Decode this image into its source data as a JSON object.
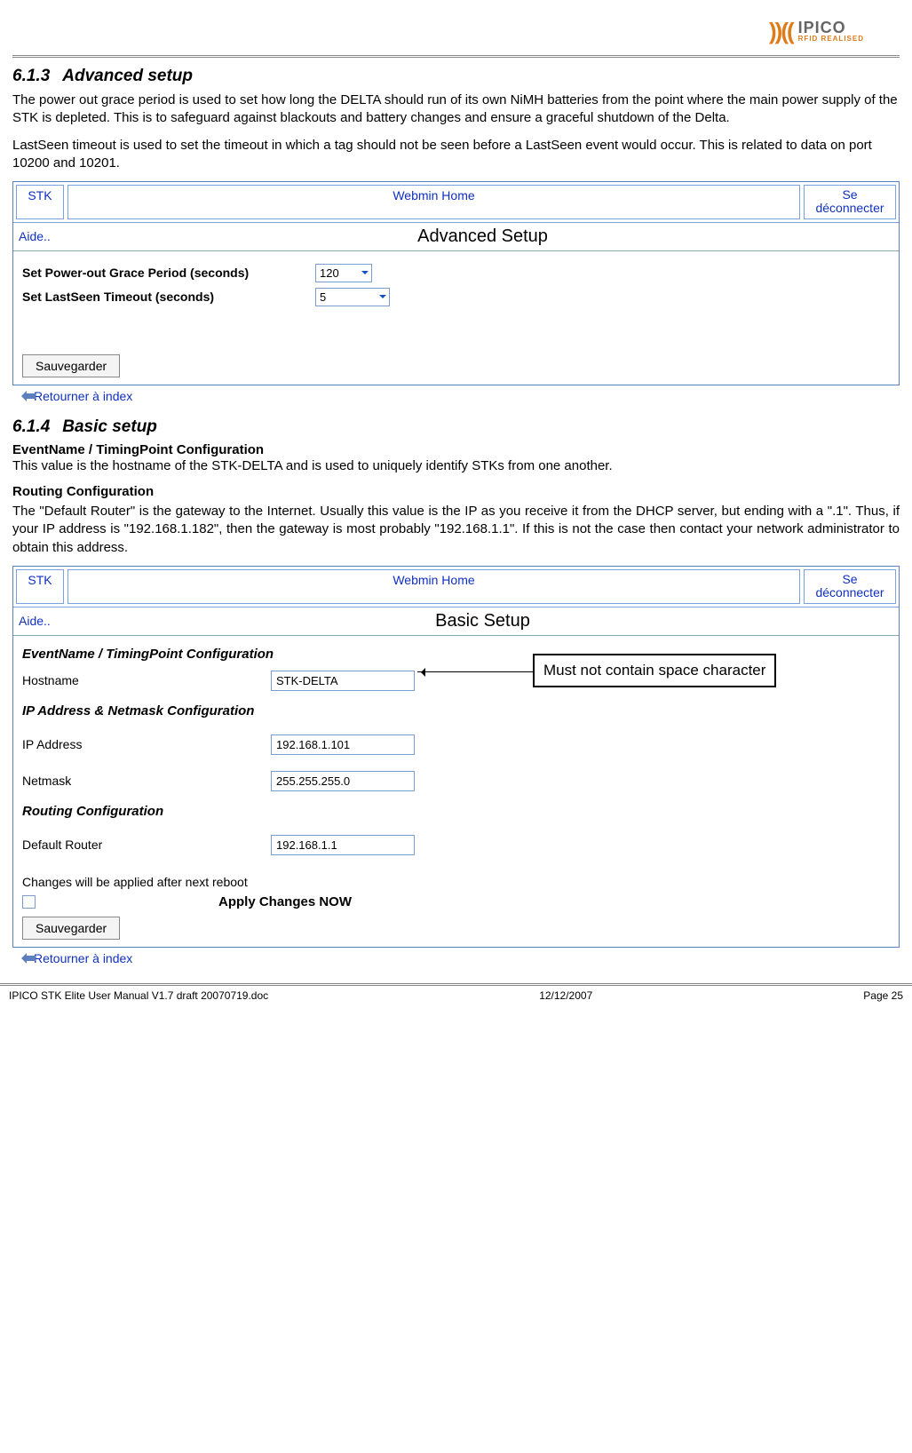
{
  "logo": {
    "brand": "IPICO",
    "tagline": "RFID REALISED"
  },
  "section1": {
    "number": "6.1.3",
    "title": "Advanced setup",
    "para1": "The power out grace period is used to set how long the DELTA should run of its own NiMH batteries from the point where the main power supply of the STK is depleted. This is to safeguard against blackouts and battery changes and ensure a graceful shutdown of the Delta.",
    "para2": "LastSeen timeout is used to set the timeout in which a tag should not be seen before a LastSeen event would occur. This is related to data on port 10200 and 10201."
  },
  "webmin1": {
    "stk": "STK",
    "home": "Webmin Home",
    "logout": "Se déconnecter",
    "aide": "Aide..",
    "title": "Advanced Setup",
    "grace_label": "Set Power-out Grace Period (seconds)",
    "grace_value": "120",
    "lastseen_label": "Set LastSeen Timeout (seconds)",
    "lastseen_value": "5",
    "save": "Sauvegarder",
    "return": "Retourner à index"
  },
  "section2": {
    "number": "6.1.4",
    "title": "Basic setup",
    "sub1_title": "EventName / TimingPoint Configuration",
    "sub1_body": "This value is the hostname of the STK-DELTA and is used to uniquely identify STKs from one another.",
    "sub2_title": "Routing Configuration",
    "sub2_body": "The \"Default Router\" is the gateway to the Internet. Usually this value is the IP as you receive it from the DHCP server, but ending with a \".1\". Thus, if your IP address is \"192.168.1.182\", then the gateway is most probably \"192.168.1.1\". If this is not the case then contact your network administrator to obtain this address."
  },
  "webmin2": {
    "stk": "STK",
    "home": "Webmin Home",
    "logout": "Se déconnecter",
    "aide": "Aide..",
    "title": "Basic Setup",
    "sect_event": "EventName / TimingPoint Configuration",
    "hostname_label": "Hostname",
    "hostname_value": "STK-DELTA",
    "sect_ip": "IP Address & Netmask Configuration",
    "ip_label": "IP Address",
    "ip_value": "192.168.1.101",
    "netmask_label": "Netmask",
    "netmask_value": "255.255.255.0",
    "sect_routing": "Routing Configuration",
    "router_label": "Default Router",
    "router_value": "192.168.1.1",
    "changes_note": "Changes will be applied after next reboot",
    "apply_now": "Apply Changes NOW",
    "save": "Sauvegarder",
    "return": "Retourner à index"
  },
  "callout": "Must not contain space character",
  "footer": {
    "left": "IPICO STK Elite User Manual V1.7 draft 20070719.doc",
    "center": "12/12/2007",
    "right": "Page 25"
  }
}
